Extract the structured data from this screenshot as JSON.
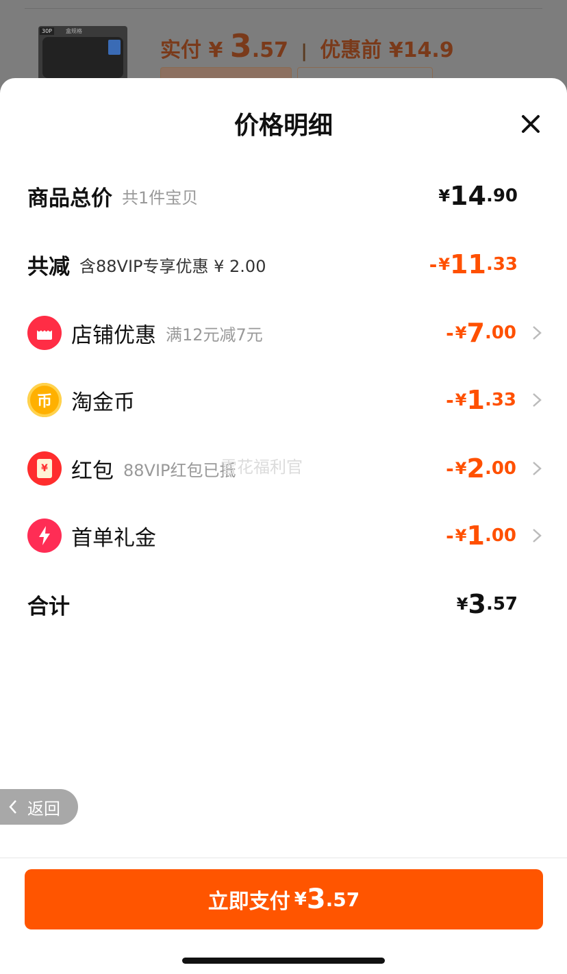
{
  "background": {
    "thumb_tag": "30P",
    "thumb_tag2": "盒规格",
    "price_label": "实付",
    "price_currency": "¥",
    "price_int": "3",
    "price_dec": ".57",
    "price_sep": "|",
    "before_label": "优惠前",
    "before_value": "¥14.9"
  },
  "sheet": {
    "title": "价格明细",
    "close_icon": "close-icon"
  },
  "rows": {
    "total": {
      "label": "商品总价",
      "sub": "共1件宝贝",
      "cur": "¥",
      "int": "14",
      "dec": ".90"
    },
    "reduce": {
      "label": "共减",
      "sub": "含88VIP专享优惠 ¥ 2.00",
      "minus": "-",
      "cur": "¥",
      "int": "11",
      "dec": ".33"
    },
    "store": {
      "label": "店铺优惠",
      "sub": "满12元减7元",
      "minus": "-",
      "cur": "¥",
      "int": "7",
      "dec": ".00",
      "icon": "store-icon",
      "color": "#ff2d45"
    },
    "coin": {
      "label": "淘金币",
      "sub": "",
      "minus": "-",
      "cur": "¥",
      "int": "1",
      "dec": ".33",
      "icon": "coin-icon",
      "icon_glyph": "币",
      "color": "#ffa800"
    },
    "redpacket": {
      "label": "红包",
      "sub": "88VIP红包已抵",
      "minus": "-",
      "cur": "¥",
      "int": "2",
      "dec": ".00",
      "icon": "red-packet-icon",
      "icon_glyph": "¥",
      "color": "#ff2d2d"
    },
    "firstorder": {
      "label": "首单礼金",
      "sub": "",
      "minus": "-",
      "cur": "¥",
      "int": "1",
      "dec": ".00",
      "icon": "lightning-icon",
      "color": "#ff2d55"
    },
    "sum": {
      "label": "合计",
      "cur": "¥",
      "int": "3",
      "dec": ".57"
    }
  },
  "watermark": "雪花福利官",
  "back": {
    "label": "返回"
  },
  "pay": {
    "label": "立即支付",
    "cur": "¥",
    "int": "3",
    "dec": ".57"
  },
  "colors": {
    "accent": "#ff5000",
    "button": "#ff5500"
  }
}
